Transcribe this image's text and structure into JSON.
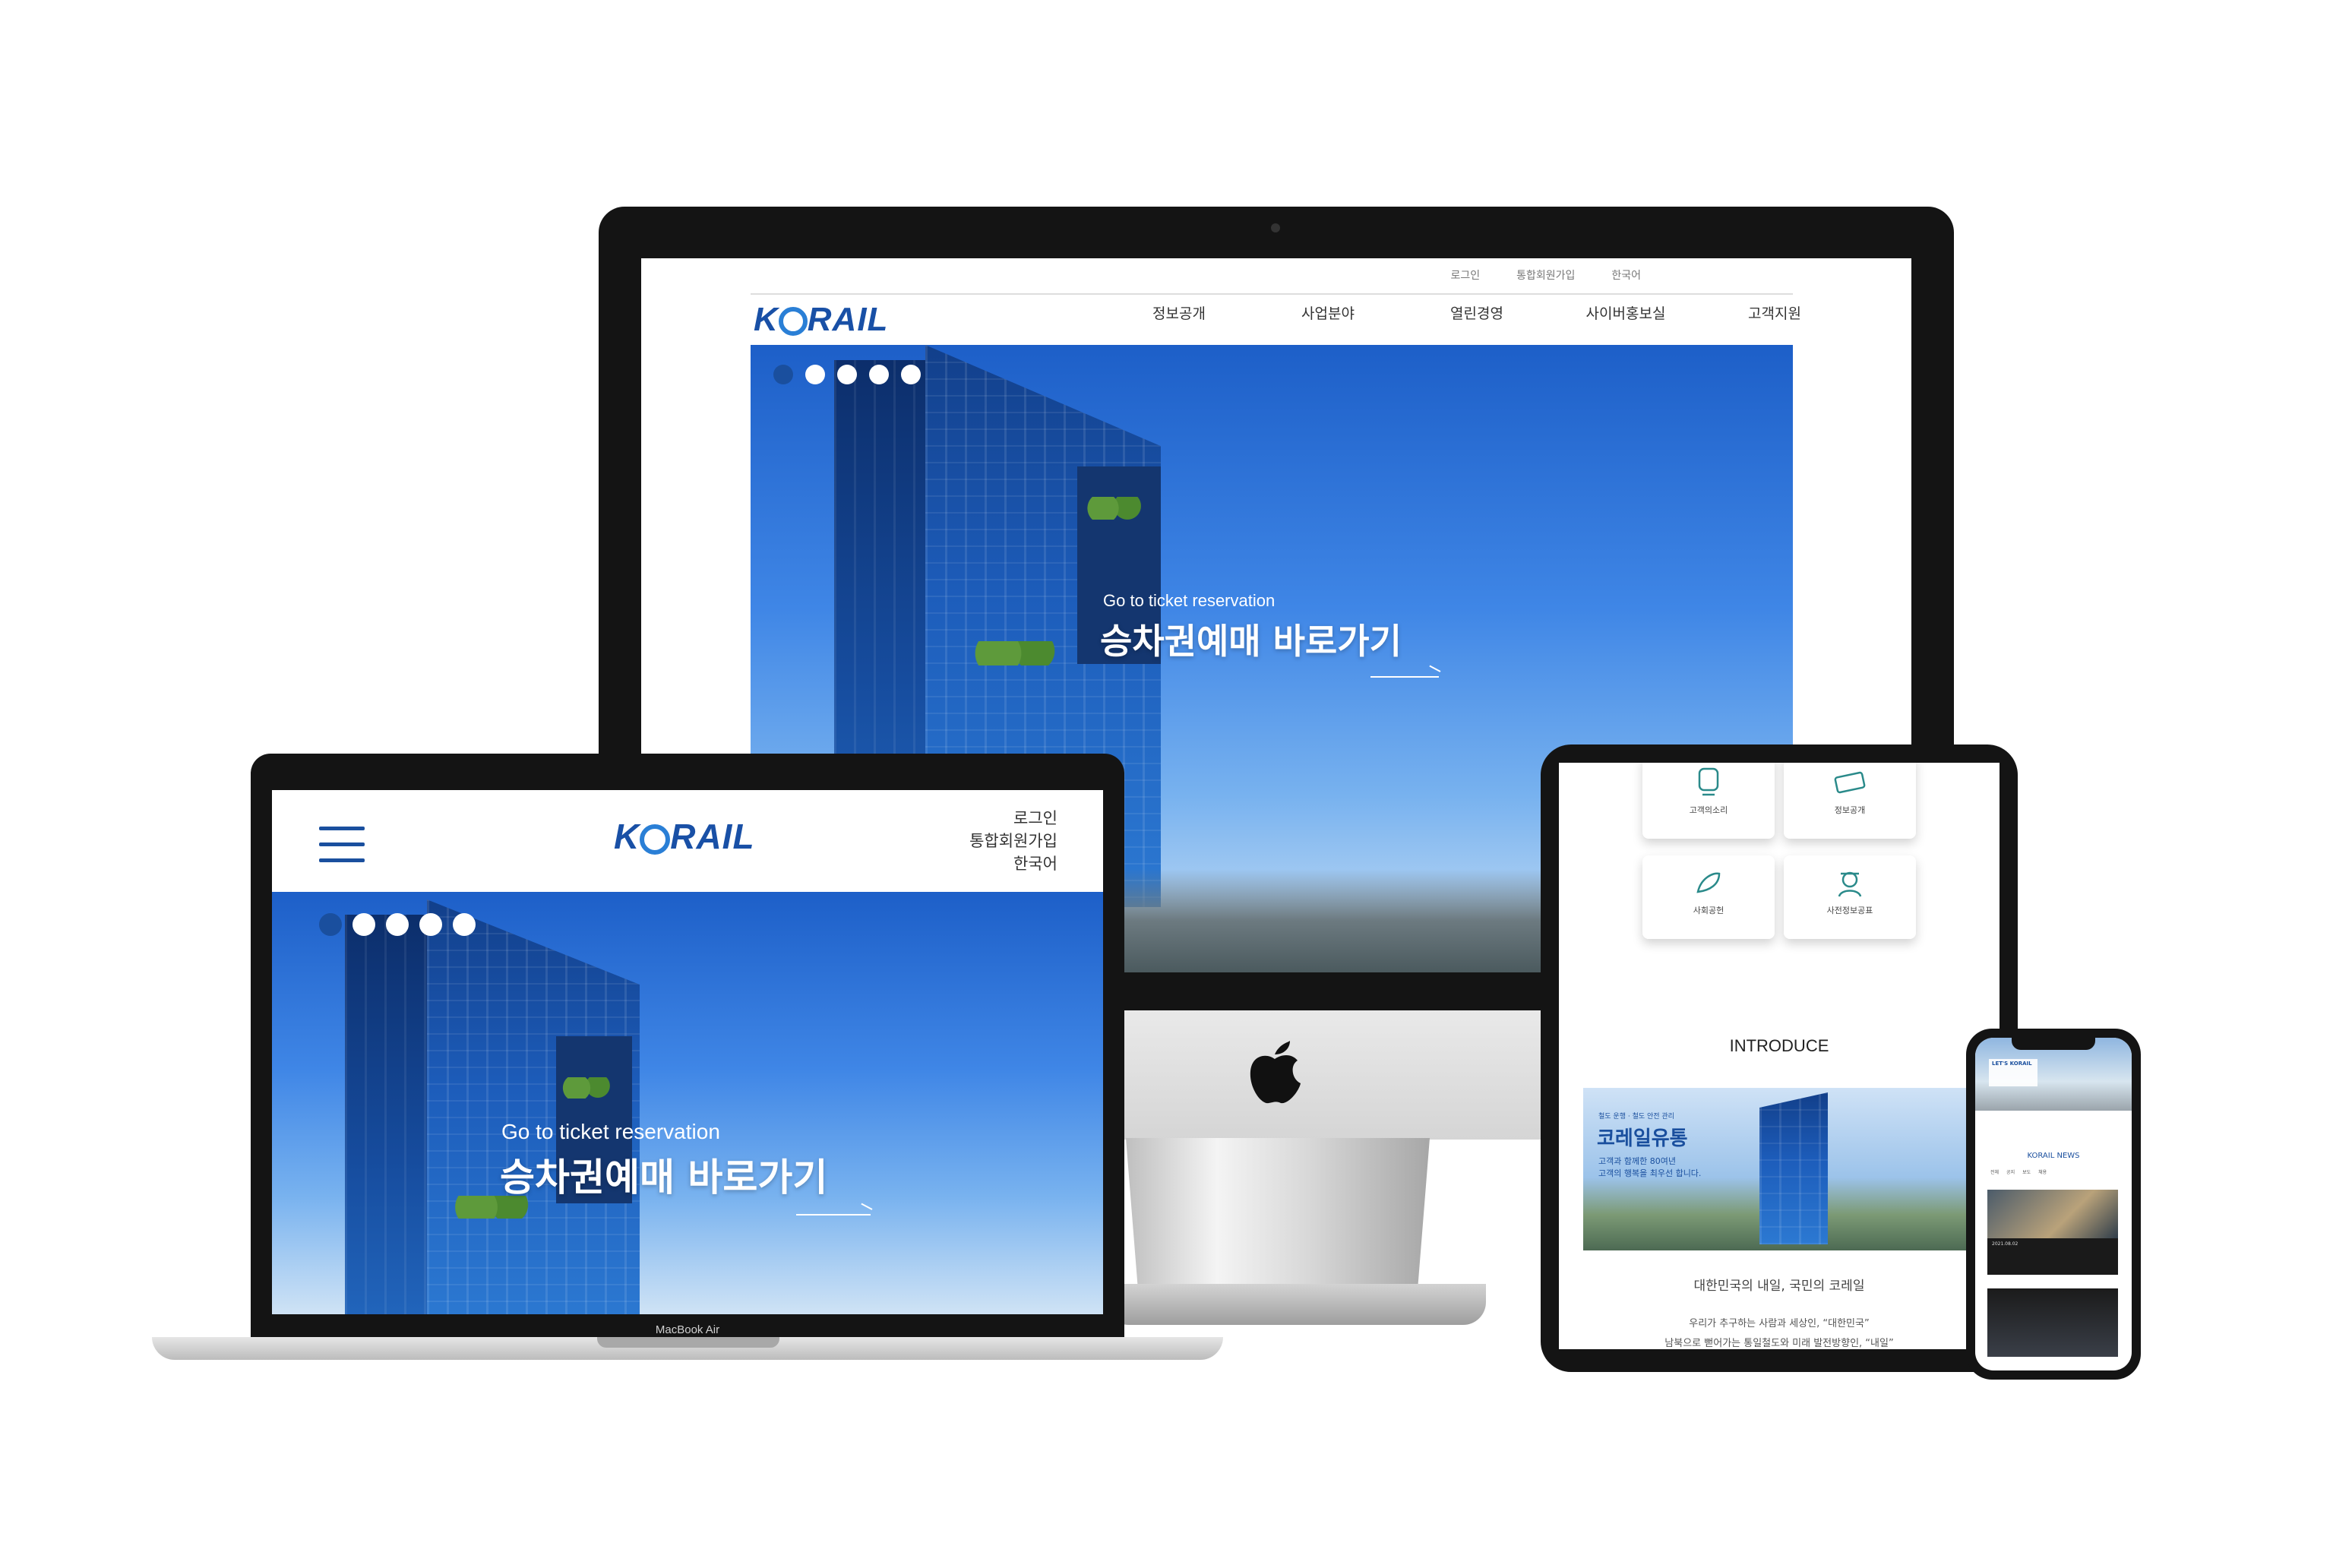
{
  "brand": {
    "logo_text_left": "K",
    "logo_text_right": "RAIL",
    "primary_color": "#1a4f9e",
    "accent_color": "#2a7fd6"
  },
  "desktop": {
    "utility_links": [
      "로그인",
      "통합회원가입",
      "한국어"
    ],
    "nav": [
      "정보공개",
      "사업분야",
      "열린경영",
      "사이버홍보실",
      "고객지원"
    ],
    "hero": {
      "subtitle": "Go to ticket reservation",
      "title": "승차권예매 바로가기",
      "slides_total": 5,
      "active_slide": 1
    }
  },
  "laptop": {
    "device_label": "MacBook Air",
    "utility_links": [
      "로그인",
      "통합회원가입",
      "한국어"
    ],
    "hero": {
      "subtitle": "Go to ticket reservation",
      "title": "승차권예매 바로가기",
      "slides_total": 5,
      "active_slide": 1
    }
  },
  "tablet": {
    "services": [
      "고객의소리",
      "정보공개",
      "사회공헌",
      "사전정보공표"
    ],
    "intro_heading": "INTRODUCE",
    "banner": {
      "kicker": "철도 운행 · 철도 안전 관리",
      "title": "코레일유통",
      "line1": "고객과 함께한 80여년",
      "line2": "고객의 행복을 최우선 합니다."
    },
    "caption": "대한민국의 내일, 국민의 코레일",
    "body_line1": "우리가 추구하는 사람과 세상인, “대한민국”",
    "body_line2": "남북으로 뻗어가는 통일철도와 미래 발전방향인, “내일”"
  },
  "phone": {
    "banner_title": "LET'S KORAIL",
    "news_heading": "KORAIL NEWS",
    "news_tabs": [
      "전체",
      "공지",
      "보도",
      "채용"
    ],
    "news_date": "2021.08.02"
  }
}
